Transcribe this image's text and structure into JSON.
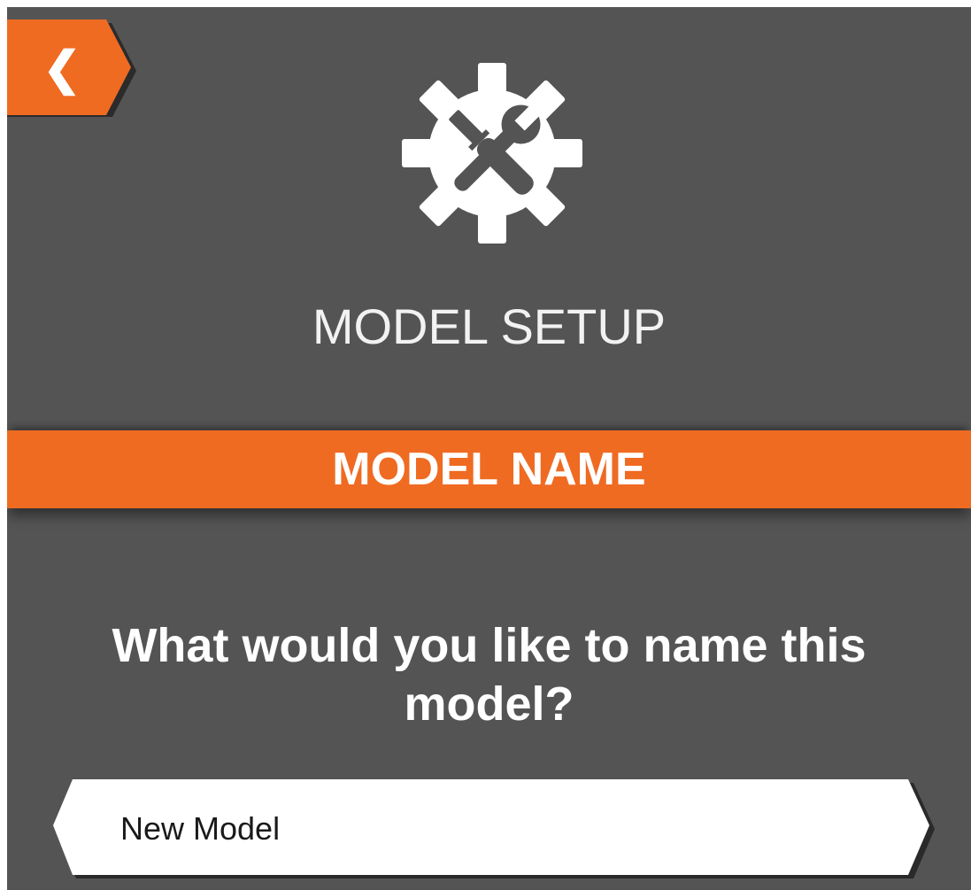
{
  "screen": {
    "title": "MODEL SETUP",
    "header_icon": "gear-wrench-screwdriver-icon"
  },
  "back_button": {
    "icon": "chevron-left-icon",
    "glyph": "❮"
  },
  "banner": {
    "label": "MODEL NAME"
  },
  "prompt": {
    "text": "What would you like to name this model?"
  },
  "name_field": {
    "value": "New Model"
  },
  "colors": {
    "background": "#545454",
    "accent": "#ef6b22",
    "text": "#ffffff",
    "field": "#ffffff",
    "field_text": "#1a1a1a"
  }
}
